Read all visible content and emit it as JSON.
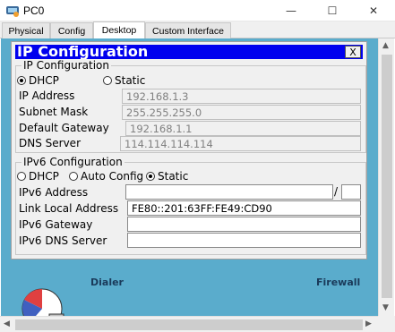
{
  "window": {
    "title": "PC0",
    "minimize_glyph": "—",
    "maximize_glyph": "☐",
    "close_glyph": "✕"
  },
  "tabs": [
    {
      "label": "Physical"
    },
    {
      "label": "Config"
    },
    {
      "label": "Desktop"
    },
    {
      "label": "Custom Interface"
    }
  ],
  "desktop_labels": {
    "left": "Dialer",
    "right": "Firewall"
  },
  "ip_config": {
    "title": "IP Configuration",
    "close_label": "X",
    "ipv4": {
      "group_title": "IP Configuration",
      "dhcp_label": "DHCP",
      "static_label": "Static",
      "selected": "DHCP",
      "ip_address_label": "IP Address",
      "ip_address_value": "192.168.1.3",
      "subnet_mask_label": "Subnet Mask",
      "subnet_mask_value": "255.255.255.0",
      "default_gateway_label": "Default Gateway",
      "default_gateway_value": "192.168.1.1",
      "dns_server_label": "DNS Server",
      "dns_server_value": "114.114.114.114"
    },
    "ipv6": {
      "group_title": "IPv6 Configuration",
      "dhcp_label": "DHCP",
      "auto_config_label": "Auto Config",
      "static_label": "Static",
      "selected": "Static",
      "ipv6_address_label": "IPv6 Address",
      "ipv6_address_value": "",
      "prefix_separator": "/",
      "prefix_value": "",
      "link_local_label": "Link Local Address",
      "link_local_value": "FE80::201:63FF:FE49:CD90",
      "gateway_label": "IPv6 Gateway",
      "gateway_value": "",
      "dns_label": "IPv6 DNS Server",
      "dns_value": ""
    }
  },
  "scrollbars": {
    "up": "▲",
    "down": "▼",
    "left": "◀",
    "right": "▶"
  },
  "colors": {
    "desktop_bg": "#5aaccc",
    "dialog_title_bg": "#0000ee",
    "dialog_bg": "#f0f0f0"
  }
}
